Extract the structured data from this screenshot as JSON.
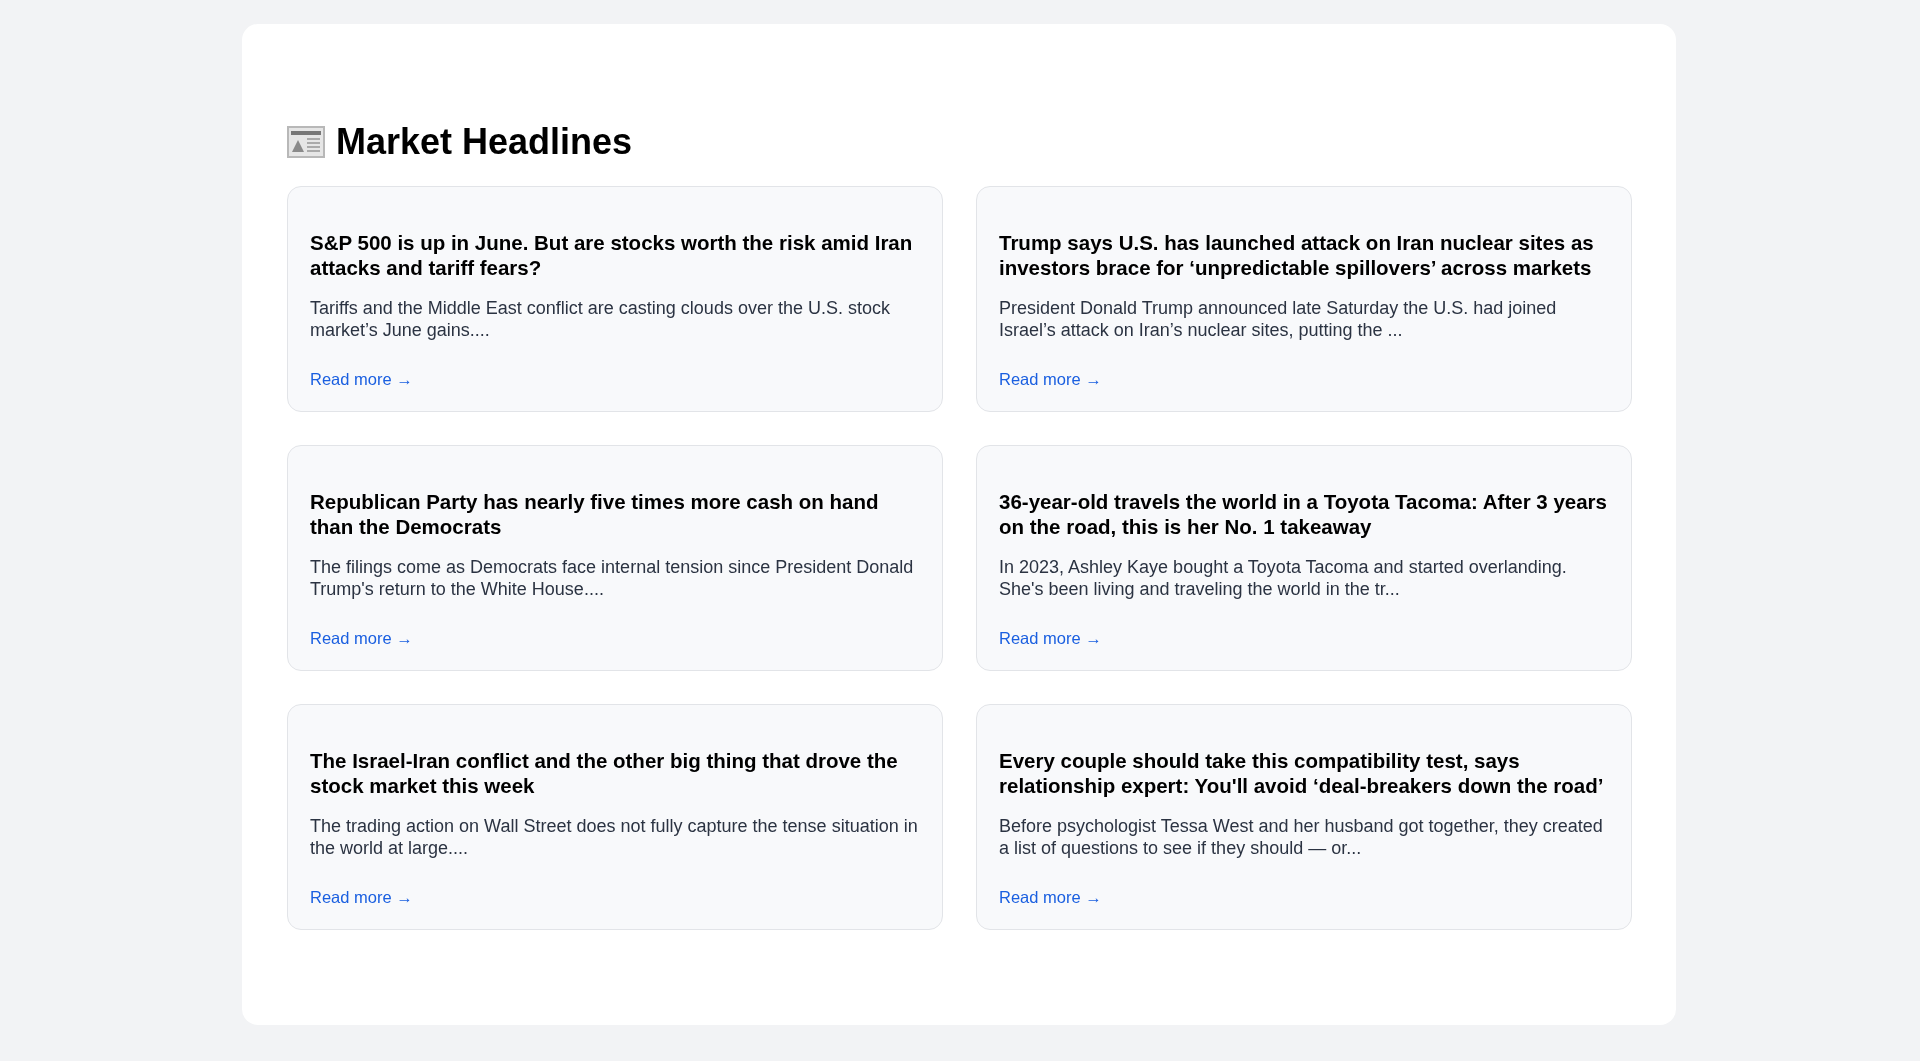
{
  "title": "Market Headlines",
  "articles": [
    {
      "headline": "S&P 500 is up in June. But are stocks worth the risk amid Iran attacks and tariff fears?",
      "summary": "Tariffs and the Middle East conflict are casting clouds over the U.S. stock market’s June gains....",
      "link": "Read more →"
    },
    {
      "headline": "Trump says U.S. has launched attack on Iran nuclear sites as investors brace for ‘unpredictable spillovers’ across markets",
      "summary": "President Donald Trump announced late Saturday the U.S. had joined Israel’s attack on Iran’s nuclear sites, putting the ...",
      "link": "Read more →"
    },
    {
      "headline": "Republican Party has nearly five times more cash on hand than the Democrats",
      "summary": "The filings come as Democrats face internal tension since President Donald Trump's return to the White House....",
      "link": "Read more →"
    },
    {
      "headline": "36-year-old travels the world in a Toyota Tacoma: After 3 years on the road, this is her No. 1 takeaway",
      "summary": "In 2023, Ashley Kaye bought a Toyota Tacoma and started overlanding. She's been living and traveling the world in the tr...",
      "link": "Read more →"
    },
    {
      "headline": "The Israel-Iran conflict and the other big thing that drove the stock market this week",
      "summary": "The trading action on Wall Street does not fully capture the tense situation in the world at large....",
      "link": "Read more →"
    },
    {
      "headline": "Every couple should take this compatibility test, says relationship expert: You'll avoid ‘deal-breakers down the road’",
      "summary": "Before psychologist Tessa West and her husband got together, they created a list of questions to see if they should — or...",
      "link": "Read more →"
    }
  ]
}
